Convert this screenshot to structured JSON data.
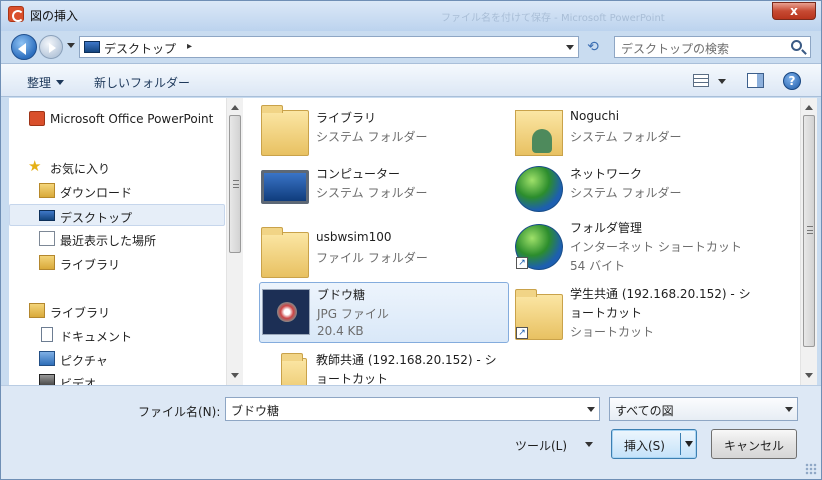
{
  "window": {
    "title": "図の挿入",
    "background_title": "ファイル名を付けて保存 - Microsoft PowerPoint",
    "close_label": "x"
  },
  "address": {
    "location": "デスクトップ",
    "separator": "▸"
  },
  "search": {
    "placeholder": "デスクトップの検索"
  },
  "toolbar": {
    "organize_label": "整理",
    "new_folder_label": "新しいフォルダー",
    "help_label": "?"
  },
  "nav_pane": {
    "items": [
      {
        "label": "Microsoft Office PowerPoint",
        "icon": "powerpoint-icon"
      },
      {
        "label": "お気に入り",
        "icon": "star-icon"
      },
      {
        "label": "ダウンロード",
        "icon": "downloads-folder-icon"
      },
      {
        "label": "デスクトップ",
        "icon": "desktop-icon",
        "selected": true
      },
      {
        "label": "最近表示した場所",
        "icon": "recent-places-icon"
      },
      {
        "label": "ライブラリ",
        "icon": "library-icon"
      },
      {
        "label": "ライブラリ",
        "icon": "library-icon"
      },
      {
        "label": "ドキュメント",
        "icon": "document-icon"
      },
      {
        "label": "ピクチャ",
        "icon": "pictures-icon"
      },
      {
        "label": "ビデオ",
        "icon": "video-icon"
      }
    ]
  },
  "files": [
    {
      "name": "ライブラリ",
      "lines": [
        "システム フォルダー"
      ],
      "icon": "library-folder-icon"
    },
    {
      "name": "Noguchi",
      "lines": [
        "システム フォルダー"
      ],
      "icon": "user-folder-icon"
    },
    {
      "name": "コンピューター",
      "lines": [
        "システム フォルダー"
      ],
      "icon": "computer-icon"
    },
    {
      "name": "ネットワーク",
      "lines": [
        "システム フォルダー"
      ],
      "icon": "network-icon"
    },
    {
      "name": "usbwsim100",
      "lines": [
        "ファイル フォルダー"
      ],
      "icon": "folder-icon"
    },
    {
      "name": "フォルダ管理",
      "lines": [
        "インターネット ショートカット",
        "54 バイト"
      ],
      "icon": "internet-shortcut-icon"
    },
    {
      "name": "ブドウ糖",
      "lines": [
        "JPG ファイル",
        "20.4 KB"
      ],
      "icon": "jpg-image-icon",
      "selected": true
    },
    {
      "name": "学生共通 (192.168.20.152) - シ",
      "name2": "ョートカット",
      "lines": [
        "ショートカット"
      ],
      "icon": "network-shortcut-icon"
    },
    {
      "name": "教師共通 (192.168.20.152) - シ",
      "name2": "ョートカット",
      "lines": [],
      "icon": "folder-shortcut-icon"
    }
  ],
  "bottom": {
    "filename_label": "ファイル名(N):",
    "filename_value": "ブドウ糖",
    "filetype_value": "すべての図",
    "tools_label": "ツール(L)",
    "insert_label": "挿入(S)",
    "cancel_label": "キャンセル"
  }
}
